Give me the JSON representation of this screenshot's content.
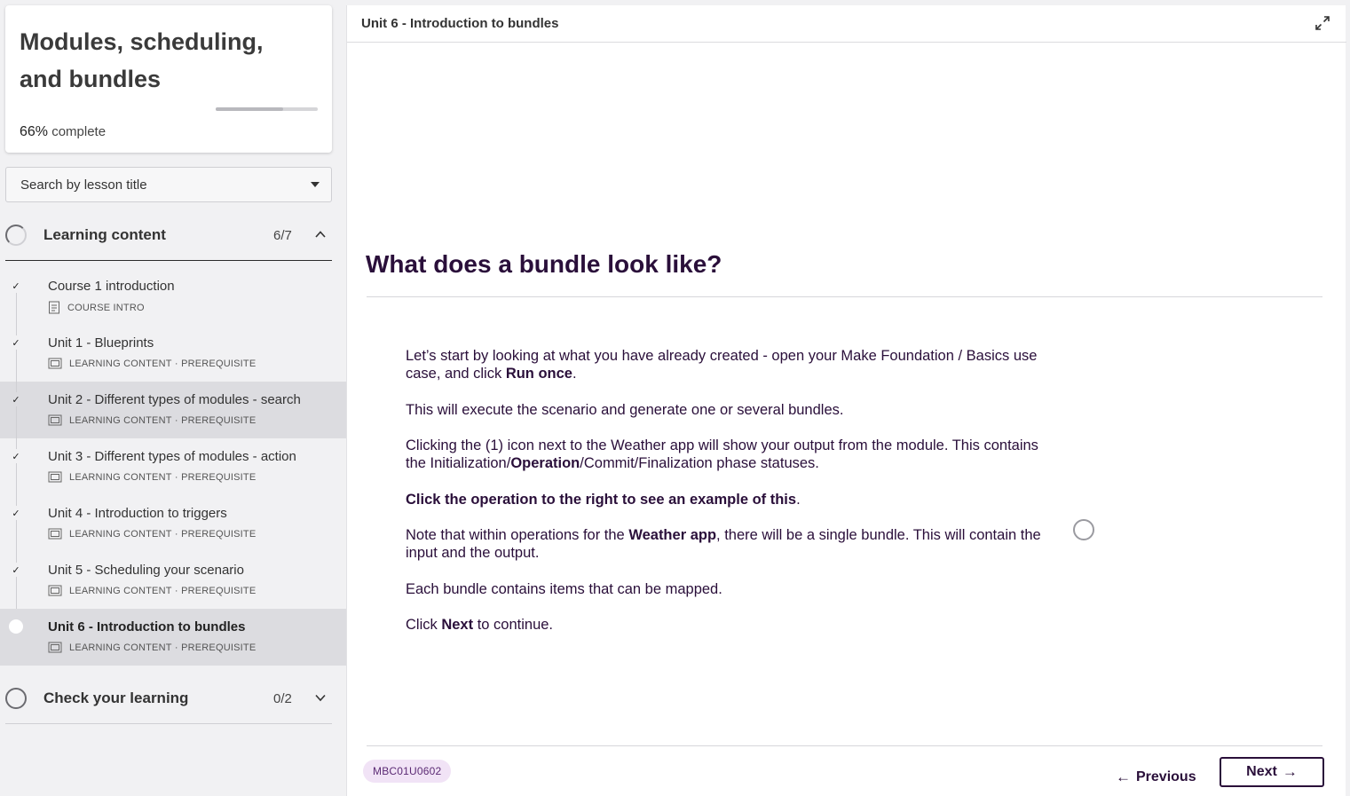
{
  "course": {
    "title": "Modules, scheduling, and bundles",
    "progress_percent": "66%",
    "progress_label": "complete",
    "progress_fraction": 0.66
  },
  "search": {
    "label": "Search by lesson title"
  },
  "sections": {
    "learning": {
      "title": "Learning content",
      "count": "6/7",
      "expanded": true
    },
    "check": {
      "title": "Check your learning",
      "count": "0/2",
      "expanded": false
    }
  },
  "lessons": [
    {
      "title": "Course 1 introduction",
      "type": "COURSE INTRO",
      "tag": "",
      "icon": "document-icon",
      "status": "complete"
    },
    {
      "title": "Unit 1 - Blueprints",
      "type": "LEARNING CONTENT",
      "tag": "PREREQUISITE",
      "icon": "slides-icon",
      "status": "complete"
    },
    {
      "title": "Unit 2 - Different types of modules - search",
      "type": "LEARNING CONTENT",
      "tag": "PREREQUISITE",
      "icon": "slides-icon",
      "status": "complete"
    },
    {
      "title": "Unit 3 - Different types of modules - action",
      "type": "LEARNING CONTENT",
      "tag": "PREREQUISITE",
      "icon": "slides-icon",
      "status": "complete"
    },
    {
      "title": "Unit 4 - Introduction to triggers",
      "type": "LEARNING CONTENT",
      "tag": "PREREQUISITE",
      "icon": "slides-icon",
      "status": "complete"
    },
    {
      "title": "Unit 5 - Scheduling your scenario",
      "type": "LEARNING CONTENT",
      "tag": "PREREQUISITE",
      "icon": "slides-icon",
      "status": "complete"
    },
    {
      "title": "Unit 6 - Introduction to bundles",
      "type": "LEARNING CONTENT",
      "tag": "PREREQUISITE",
      "icon": "slides-icon",
      "status": "current"
    }
  ],
  "meta_separator": "·",
  "main": {
    "header_title": "Unit 6 - Introduction to bundles",
    "heading": "What does a bundle look like?",
    "p1_a": "Let’s start by looking at what you have already created - open your Make Foundation / Basics use case, and click ",
    "p1_b": "Run once",
    "p1_c": ".",
    "p2": "This will execute the scenario and generate one or several bundles.",
    "p3_a": "Clicking the (1) icon next to the Weather app will show your output from the module. This contains the Initialization/",
    "p3_b": "Operation",
    "p3_c": "/Commit/Finalization phase statuses.",
    "p4_a": "Click the operation to the right to see an example of this",
    "p4_b": ".",
    "p5_a": "Note that within operations for the ",
    "p5_b": "Weather app",
    "p5_c": ", there will be a single bundle. This will contain the input and the output.",
    "p6": "Each bundle contains items that can be mapped.",
    "p7_a": "Click ",
    "p7_b": "Next",
    "p7_c": " to continue."
  },
  "footer": {
    "code": "MBC01U0602",
    "previous_label": "Previous",
    "next_label": "Next",
    "prev_arrow": "←",
    "next_arrow": "→"
  },
  "icons": {
    "check": "✓",
    "expand": "expand-icon",
    "chevron_up": "chevron-up-icon",
    "chevron_down": "chevron-down-icon"
  },
  "colors": {
    "brand_dark": "#2a0f3a",
    "badge_bg": "#f1e3f6",
    "sidebar_bg": "#f1f1f3",
    "highlight_row": "#dcdce0"
  }
}
